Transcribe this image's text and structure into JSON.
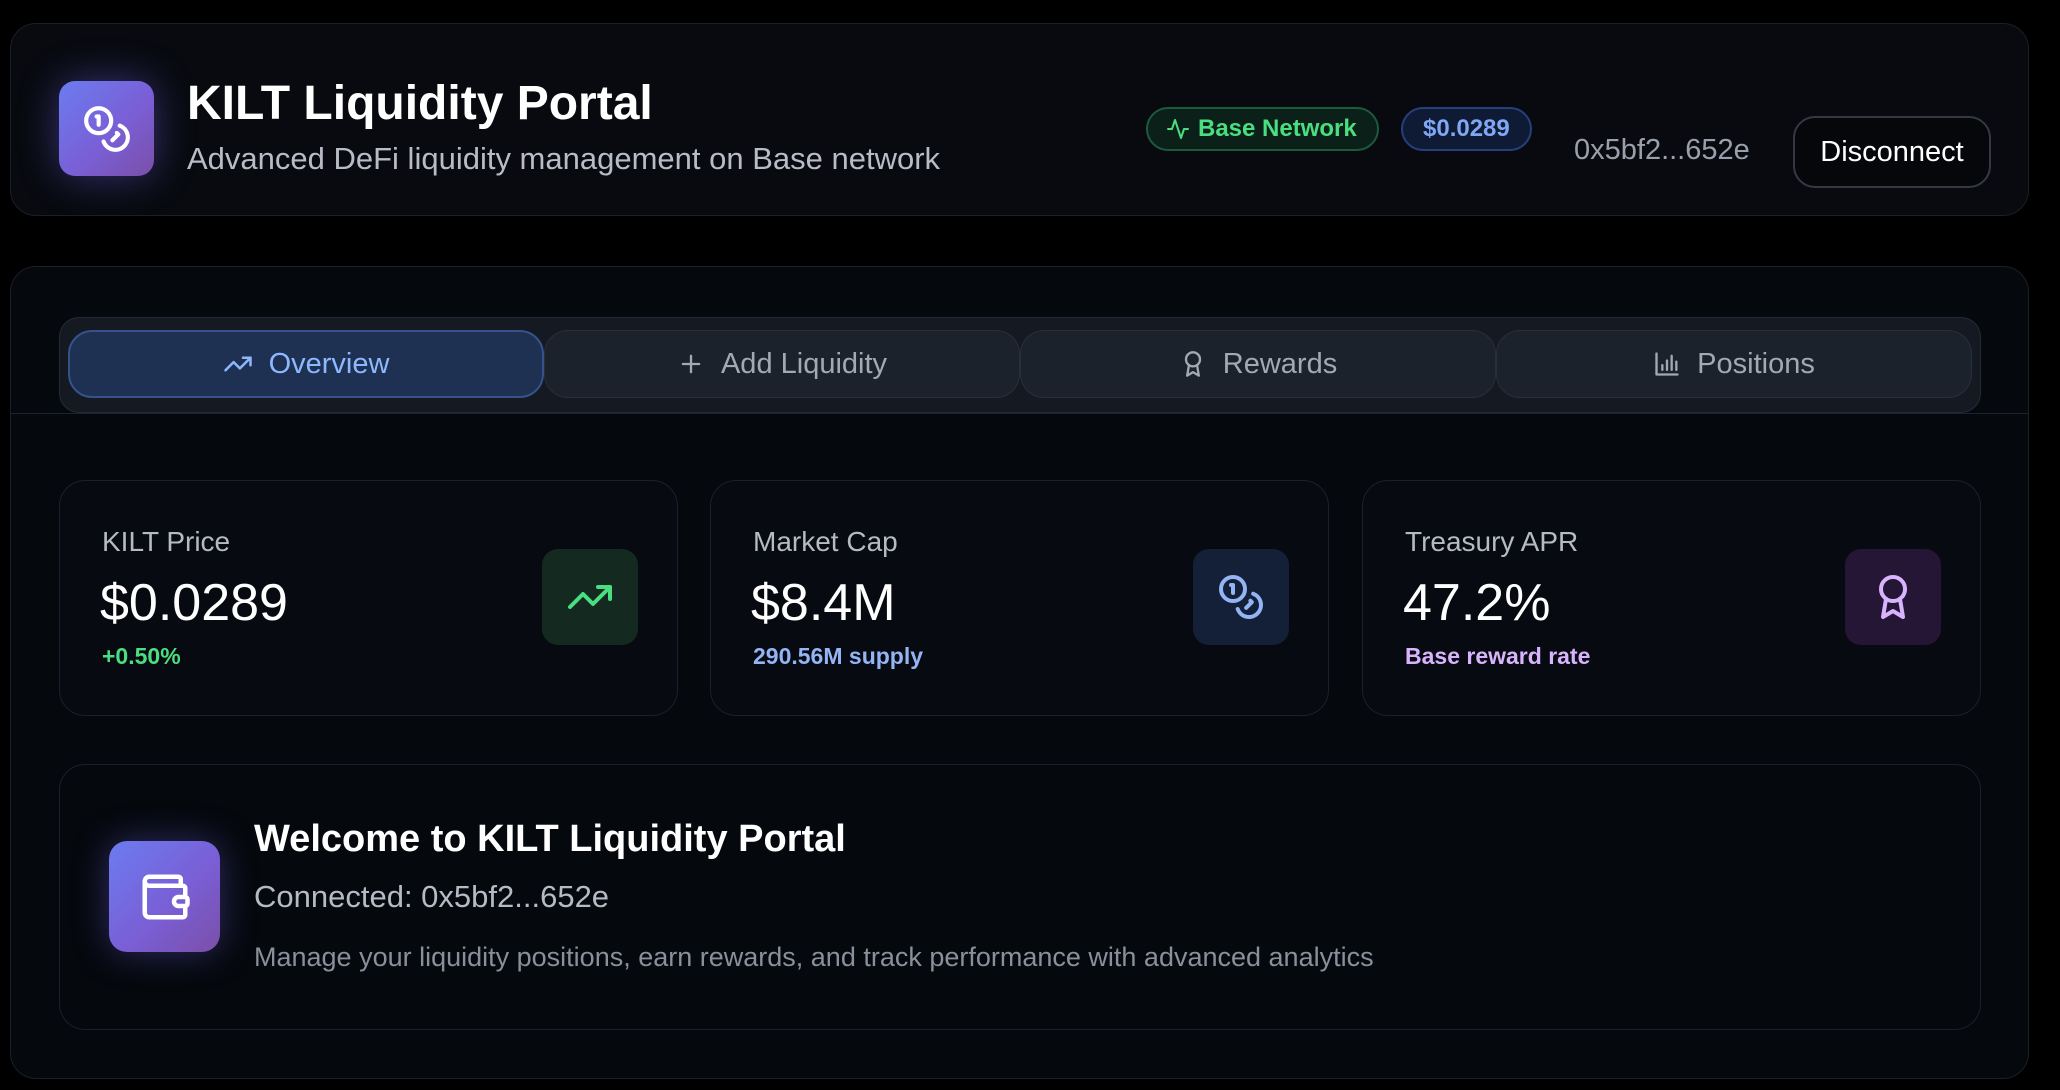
{
  "header": {
    "title": "KILT Liquidity Portal",
    "subtitle": "Advanced DeFi liquidity management on Base network",
    "network_badge": "Base Network",
    "price_badge": "$0.0289",
    "wallet_address": "0x5bf2...652e",
    "disconnect_label": "Disconnect"
  },
  "tabs": [
    {
      "label": "Overview",
      "icon": "trending-up-icon",
      "active": true
    },
    {
      "label": "Add Liquidity",
      "icon": "plus-icon",
      "active": false
    },
    {
      "label": "Rewards",
      "icon": "award-icon",
      "active": false
    },
    {
      "label": "Positions",
      "icon": "bar-chart-icon",
      "active": false
    }
  ],
  "stats": [
    {
      "label": "KILT Price",
      "value": "$0.0289",
      "sub": "+0.50%",
      "icon": "trending-up-icon",
      "accent": "#4ade80"
    },
    {
      "label": "Market Cap",
      "value": "$8.4M",
      "sub": "290.56M supply",
      "icon": "coins-icon",
      "accent": "#93b4f5"
    },
    {
      "label": "Treasury APR",
      "value": "47.2%",
      "sub": "Base reward rate",
      "icon": "award-icon",
      "accent": "#d8b4fe"
    }
  ],
  "welcome": {
    "title": "Welcome to KILT Liquidity Portal",
    "connected": "Connected: 0x5bf2...652e",
    "description": "Manage your liquidity positions, earn rewards, and track performance with advanced analytics"
  },
  "colors": {
    "accent_green": "#4ade80",
    "accent_blue": "#8db7ff",
    "accent_purple": "#d8b4fe",
    "brand_gradient_start": "#6b7cf0",
    "brand_gradient_end": "#7b4fa8"
  }
}
